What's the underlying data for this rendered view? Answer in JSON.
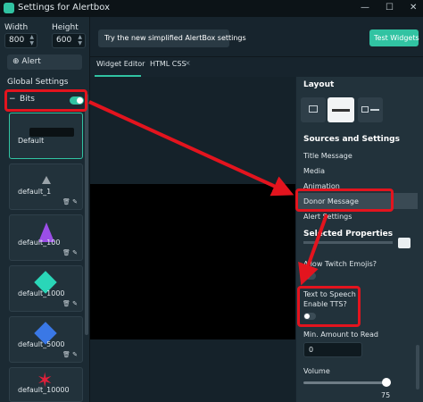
{
  "window": {
    "title": "Settings for Alertbox",
    "controls": [
      "—",
      "☐",
      "✕"
    ]
  },
  "sidebar": {
    "width_label": "Width",
    "width_value": "800",
    "height_label": "Height",
    "height_value": "600",
    "add_alert_label": "Alert",
    "global_settings_label": "Global Settings",
    "bits_label": "Bits",
    "variations": [
      {
        "name": "Default"
      },
      {
        "name": "default_1"
      },
      {
        "name": "default_100"
      },
      {
        "name": "default_1000"
      },
      {
        "name": "default_5000"
      },
      {
        "name": "default_10000"
      }
    ]
  },
  "toolbar": {
    "simplified_label": "Try the new simplified AlertBox settings",
    "test_label": "Test Widgets"
  },
  "editor_tabs": [
    {
      "label": "Widget Editor"
    },
    {
      "label": "HTML CSS"
    }
  ],
  "panel": {
    "layout_heading": "Layout",
    "sources_heading": "Sources and Settings",
    "sources": [
      "Title Message",
      "Media",
      "Animation",
      "Donor Message",
      "Alert Settings"
    ],
    "selected_heading": "Selected Properties",
    "emojis_label": "Allow Twitch Emojis?",
    "tts_line1": "Text to Speech",
    "tts_line2": "Enable TTS?",
    "min_amount_label": "Min. Amount to Read",
    "min_amount_value": "0",
    "volume_label": "Volume",
    "volume_value": "75"
  },
  "colors": {
    "accent": "#31c3a2",
    "highlight": "#e3141e"
  }
}
